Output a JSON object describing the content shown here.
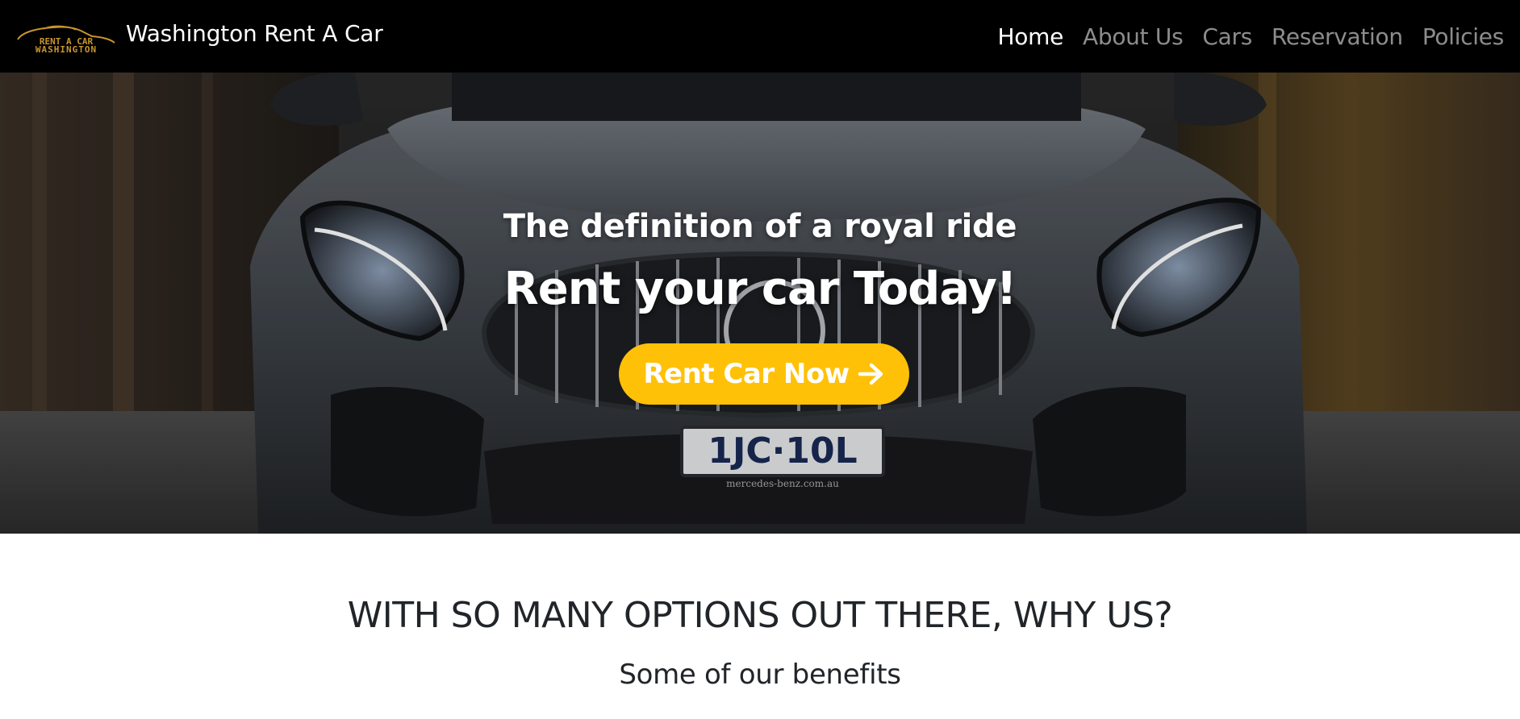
{
  "navbar": {
    "logo": {
      "line1": "RENT A CAR",
      "line2": "WASHINGTON",
      "color": "#c8952b"
    },
    "brand_name": "Washington Rent A Car",
    "links": [
      {
        "label": "Home",
        "active": true
      },
      {
        "label": "About Us",
        "active": false
      },
      {
        "label": "Cars",
        "active": false
      },
      {
        "label": "Reservation",
        "active": false
      },
      {
        "label": "Policies",
        "active": false
      }
    ]
  },
  "hero": {
    "tagline": "The definition of a royal ride",
    "title": "Rent your car Today!",
    "cta_label": "Rent Car Now",
    "cta_icon": "arrow-right-icon",
    "cta_color": "#ffc107",
    "license_plate": "1JC·10L",
    "plate_caption": "mercedes-benz.com.au"
  },
  "benefits": {
    "heading": "WITH SO MANY OPTIONS OUT THERE, WHY US?",
    "subheading": "Some of our benefits"
  }
}
